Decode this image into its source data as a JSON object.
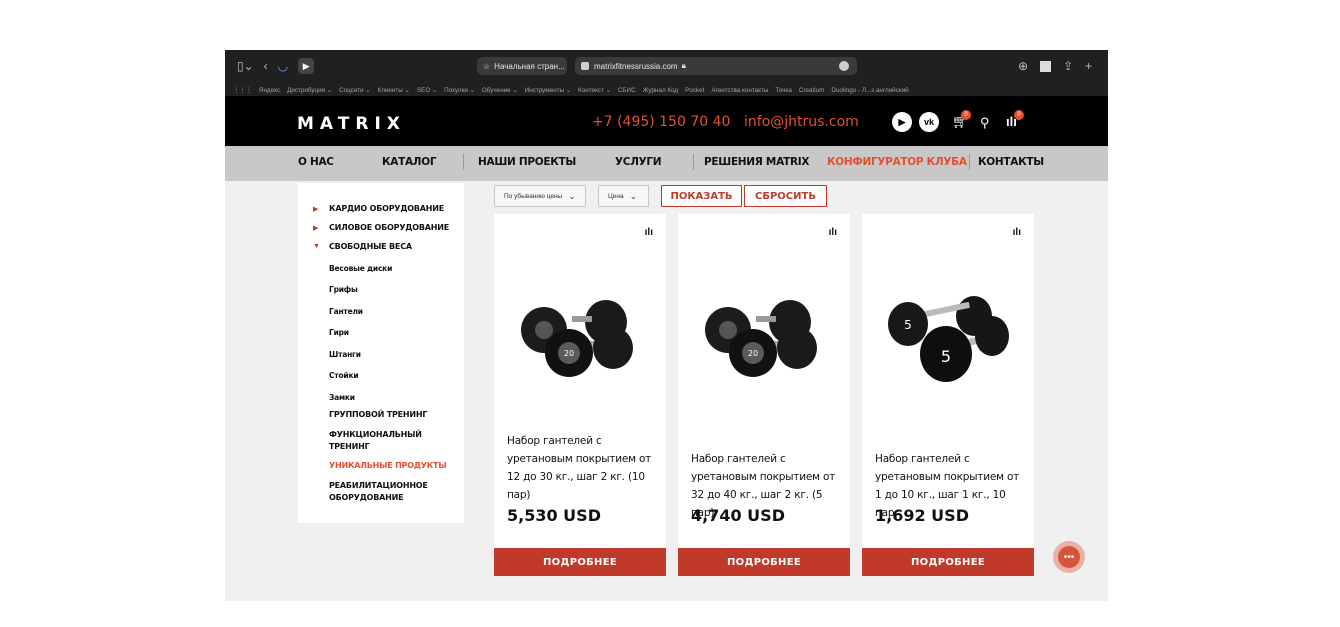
{
  "browser": {
    "tab_label": "Начальная стран...",
    "url": "matrixfitnessrussia.com",
    "bookmarks": [
      "Яндекс",
      "Дистрибуция ⌄",
      "Соцсети ⌄",
      "Клиенты ⌄",
      "SEO ⌄",
      "Покупки ⌄",
      "Обучение ⌄",
      "Инструменты ⌄",
      "Контекст ⌄",
      "СБИС",
      "Журнал Код",
      "Pocket",
      "Агентства контакты",
      "Точка",
      "Creatium",
      "Duolingo - Л...з английский"
    ]
  },
  "header": {
    "logo": "MATRIX",
    "phone": "+7 (495) 150 70 40",
    "email": "info@jhtrus.com",
    "cart_count": "0",
    "compare_count": "0"
  },
  "nav": [
    "О НАС",
    "КАТАЛОГ",
    "НАШИ ПРОЕКТЫ",
    "УСЛУГИ",
    "РЕШЕНИЯ MATRIX",
    "КОНФИГУРАТОР КЛУБА",
    "КОНТАКТЫ"
  ],
  "sidebar": {
    "cats": [
      "КАРДИО ОБОРУДОВАНИЕ",
      "СИЛОВОЕ ОБОРУДОВАНИЕ",
      "СВОБОДНЫЕ ВЕСА"
    ],
    "subs": [
      "Весовые диски",
      "Грифы",
      "Гантели",
      "Гири",
      "Штанги",
      "Стойки",
      "Замки"
    ],
    "group": "ГРУППОВОЙ ТРЕНИНГ",
    "functional": "ФУНКЦИОНАЛЬНЫЙ ТРЕНИНГ",
    "unique": "УНИКАЛЬНЫЕ ПРОДУКТЫ",
    "rehab": "РЕАБИЛИТАЦИОННОЕ ОБОРУДОВАНИЕ"
  },
  "filters": {
    "sort": "По убыванию цены",
    "price": "Цена",
    "show": "ПОКАЗАТЬ",
    "reset": "СБРОСИТЬ"
  },
  "products": [
    {
      "title": "Набор гантелей с уретановым покрытием от 12 до 30 кг., шаг 2 кг. (10 пар)",
      "price": "5,530 USD",
      "button": "ПОДРОБНЕЕ",
      "plate": "20"
    },
    {
      "title": "Набор гантелей с уретановым покрытием от 32 до 40 кг., шаг 2 кг. (5 пар)",
      "price": "4,740 USD",
      "button": "ПОДРОБНЕЕ",
      "plate": "20"
    },
    {
      "title": "Набор гантелей с уретановым покрытием от 1 до 10 кг., шаг 1 кг., 10 пар",
      "price": "1,692 USD",
      "button": "ПОДРОБНЕЕ",
      "plate": "5"
    }
  ],
  "colors": {
    "accent": "#c0392b",
    "header_bg": "#000000",
    "nav_bg": "#c8c8c8"
  }
}
